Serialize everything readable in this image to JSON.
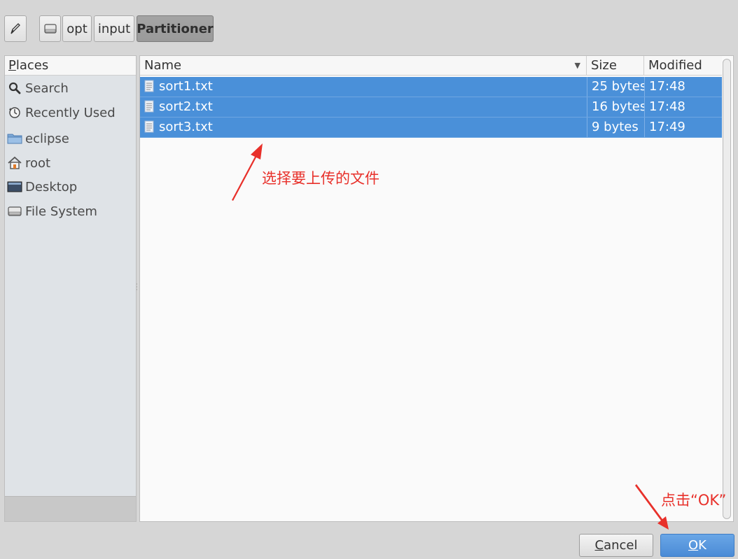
{
  "toolbar": {
    "edit_location_icon": "pencil-icon",
    "drive_icon": "drive-icon",
    "path_segments": [
      {
        "label": "opt"
      },
      {
        "label": "input"
      },
      {
        "label": "Partitioner"
      }
    ]
  },
  "places": {
    "header_first": "P",
    "header_rest": "laces",
    "items": [
      {
        "label": "Search",
        "icon": "search-icon"
      },
      {
        "label": "Recently Used",
        "icon": "recent-icon"
      },
      {
        "label": "eclipse",
        "icon": "folder-icon"
      },
      {
        "label": "root",
        "icon": "home-icon"
      },
      {
        "label": "Desktop",
        "icon": "desktop-icon"
      },
      {
        "label": "File System",
        "icon": "drive-icon"
      }
    ]
  },
  "file_list": {
    "columns": {
      "name": "Name",
      "size": "Size",
      "modified": "Modified"
    },
    "rows": [
      {
        "name": "sort1.txt",
        "size": "25 bytes",
        "modified": "17:48"
      },
      {
        "name": "sort2.txt",
        "size": "16 bytes",
        "modified": "17:48"
      },
      {
        "name": "sort3.txt",
        "size": "9 bytes",
        "modified": "17:49"
      }
    ]
  },
  "annotations": {
    "select_files": "选择要上传的文件",
    "click_ok": "点击“OK”"
  },
  "buttons": {
    "cancel_first": "C",
    "cancel_rest": "ancel",
    "ok_first": "O",
    "ok_rest": "K"
  },
  "colors": {
    "selection": "#4a90d9",
    "annotation": "#e8302a"
  }
}
